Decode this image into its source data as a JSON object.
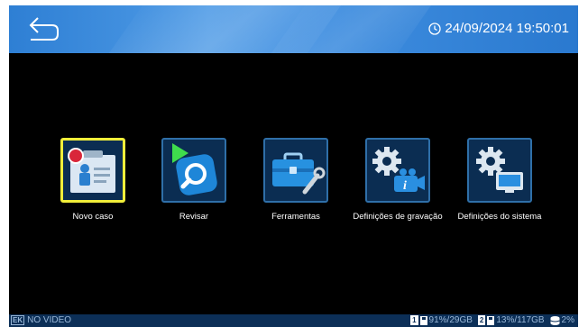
{
  "header": {
    "datetime": "24/09/2024 19:50:01"
  },
  "menu": {
    "items": [
      {
        "label": "Novo caso",
        "icon": "new-case-icon",
        "selected": true
      },
      {
        "label": "Revisar",
        "icon": "review-icon",
        "selected": false
      },
      {
        "label": "Ferramentas",
        "icon": "toolbox-icon",
        "selected": false
      },
      {
        "label": "Definições de gravação",
        "icon": "recording-settings-icon",
        "selected": false
      },
      {
        "label": "Definições do sistema",
        "icon": "system-settings-icon",
        "selected": false
      }
    ]
  },
  "status": {
    "ek": "EK",
    "video": "NO VIDEO",
    "disk1_num": "1",
    "disk1": "91%/29GB",
    "disk2_num": "2",
    "disk2": "13%/117GB",
    "db": "2%"
  },
  "colors": {
    "header_blue": "#3f8ee0",
    "tile_blue": "#0b2d52",
    "selected_border": "#f1ee3a",
    "status_bar": "#0c2f57"
  }
}
